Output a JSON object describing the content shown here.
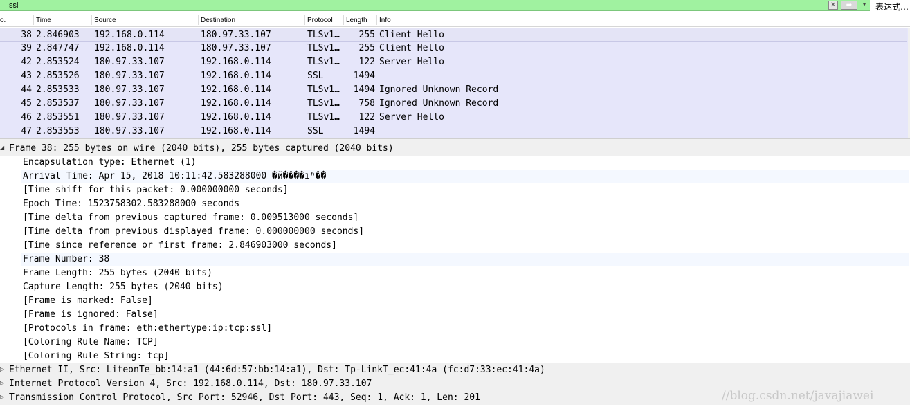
{
  "filter": {
    "value": "ssl",
    "clear_icon": "clear-x-icon",
    "apply_icon": "arrow-right-icon",
    "dropdown_icon": "chevron-down-icon",
    "expression_label": "表达式…"
  },
  "columns": [
    "o.",
    "Time",
    "Source",
    "Destination",
    "Protocol",
    "Length",
    "Info"
  ],
  "packets": [
    {
      "no": "38",
      "time": "2.846903",
      "source": "192.168.0.114",
      "destination": "180.97.33.107",
      "protocol": "TLSv1…",
      "length": "255",
      "info": "Client Hello"
    },
    {
      "no": "39",
      "time": "2.847747",
      "source": "192.168.0.114",
      "destination": "180.97.33.107",
      "protocol": "TLSv1…",
      "length": "255",
      "info": "Client Hello"
    },
    {
      "no": "42",
      "time": "2.853524",
      "source": "180.97.33.107",
      "destination": "192.168.0.114",
      "protocol": "TLSv1…",
      "length": "122",
      "info": "Server Hello"
    },
    {
      "no": "43",
      "time": "2.853526",
      "source": "180.97.33.107",
      "destination": "192.168.0.114",
      "protocol": "SSL",
      "length": "1494",
      "info": ""
    },
    {
      "no": "44",
      "time": "2.853533",
      "source": "180.97.33.107",
      "destination": "192.168.0.114",
      "protocol": "TLSv1…",
      "length": "1494",
      "info": "Ignored Unknown Record"
    },
    {
      "no": "45",
      "time": "2.853537",
      "source": "180.97.33.107",
      "destination": "192.168.0.114",
      "protocol": "TLSv1…",
      "length": "758",
      "info": "Ignored Unknown Record"
    },
    {
      "no": "46",
      "time": "2.853551",
      "source": "180.97.33.107",
      "destination": "192.168.0.114",
      "protocol": "TLSv1…",
      "length": "122",
      "info": "Server Hello"
    },
    {
      "no": "47",
      "time": "2.853553",
      "source": "180.97.33.107",
      "destination": "192.168.0.114",
      "protocol": "SSL",
      "length": "1494",
      "info": ""
    }
  ],
  "selected_row": 0,
  "details": [
    {
      "text": "Frame 38: 255 bytes on wire (2040 bits), 255 bytes captured (2040 bits)",
      "level": 0,
      "expander": "◢"
    },
    {
      "text": "Encapsulation type: Ethernet (1)",
      "level": 1
    },
    {
      "text": "Arrival Time: Apr 15, 2018 10:11:42.583288000 �й����ı׼ʱ��",
      "level": 1,
      "highlight": true
    },
    {
      "text": "[Time shift for this packet: 0.000000000 seconds]",
      "level": 1
    },
    {
      "text": "Epoch Time: 1523758302.583288000 seconds",
      "level": 1
    },
    {
      "text": "[Time delta from previous captured frame: 0.009513000 seconds]",
      "level": 1
    },
    {
      "text": "[Time delta from previous displayed frame: 0.000000000 seconds]",
      "level": 1
    },
    {
      "text": "[Time since reference or first frame: 2.846903000 seconds]",
      "level": 1
    },
    {
      "text": "Frame Number: 38",
      "level": 1,
      "highlight": true
    },
    {
      "text": "Frame Length: 255 bytes (2040 bits)",
      "level": 1
    },
    {
      "text": "Capture Length: 255 bytes (2040 bits)",
      "level": 1
    },
    {
      "text": "[Frame is marked: False]",
      "level": 1
    },
    {
      "text": "[Frame is ignored: False]",
      "level": 1
    },
    {
      "text": "[Protocols in frame: eth:ethertype:ip:tcp:ssl]",
      "level": 1
    },
    {
      "text": "[Coloring Rule Name: TCP]",
      "level": 1
    },
    {
      "text": "[Coloring Rule String: tcp]",
      "level": 1
    },
    {
      "text": "Ethernet II, Src: LiteonTe_bb:14:a1 (44:6d:57:bb:14:a1), Dst: Tp-LinkT_ec:41:4a (fc:d7:33:ec:41:4a)",
      "level": 0,
      "expander": "▷"
    },
    {
      "text": "Internet Protocol Version 4, Src: 192.168.0.114, Dst: 180.97.33.107",
      "level": 0,
      "expander": "▷"
    },
    {
      "text": "Transmission Control Protocol, Src Port: 52946, Dst Port: 443, Seq: 1, Ack: 1, Len: 201",
      "level": 0,
      "expander": "▷"
    }
  ],
  "watermark": "//blog.csdn.net/javajiawei"
}
